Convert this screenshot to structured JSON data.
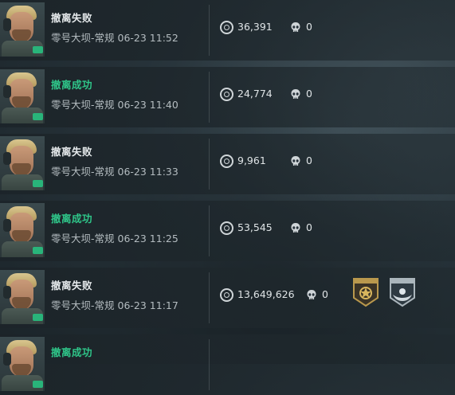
{
  "records": [
    {
      "status": "撤离失败",
      "result": "fail",
      "map": "零号大坝-常规",
      "datetime": "06-23 11:52",
      "value": "36,391",
      "kills": "0",
      "medals": []
    },
    {
      "status": "撤离成功",
      "result": "success",
      "map": "零号大坝-常规",
      "datetime": "06-23 11:40",
      "value": "24,774",
      "kills": "0",
      "medals": []
    },
    {
      "status": "撤离失败",
      "result": "fail",
      "map": "零号大坝-常规",
      "datetime": "06-23 11:33",
      "value": "9,961",
      "kills": "0",
      "medals": []
    },
    {
      "status": "撤离成功",
      "result": "success",
      "map": "零号大坝-常规",
      "datetime": "06-23 11:25",
      "value": "53,545",
      "kills": "0",
      "medals": []
    },
    {
      "status": "撤离失败",
      "result": "fail",
      "map": "零号大坝-常规",
      "datetime": "06-23 11:17",
      "value": "13,649,626",
      "kills": "0",
      "medals": [
        "gold-emblem-medal-icon",
        "silver-wing-medal-icon"
      ]
    },
    {
      "status": "撤离成功",
      "result": "success",
      "map": "",
      "datetime": "",
      "value": "",
      "kills": "",
      "medals": []
    }
  ],
  "colors": {
    "success": "#2fc78a",
    "fail": "#e6eaec",
    "text_secondary": "#b4bcc0"
  }
}
